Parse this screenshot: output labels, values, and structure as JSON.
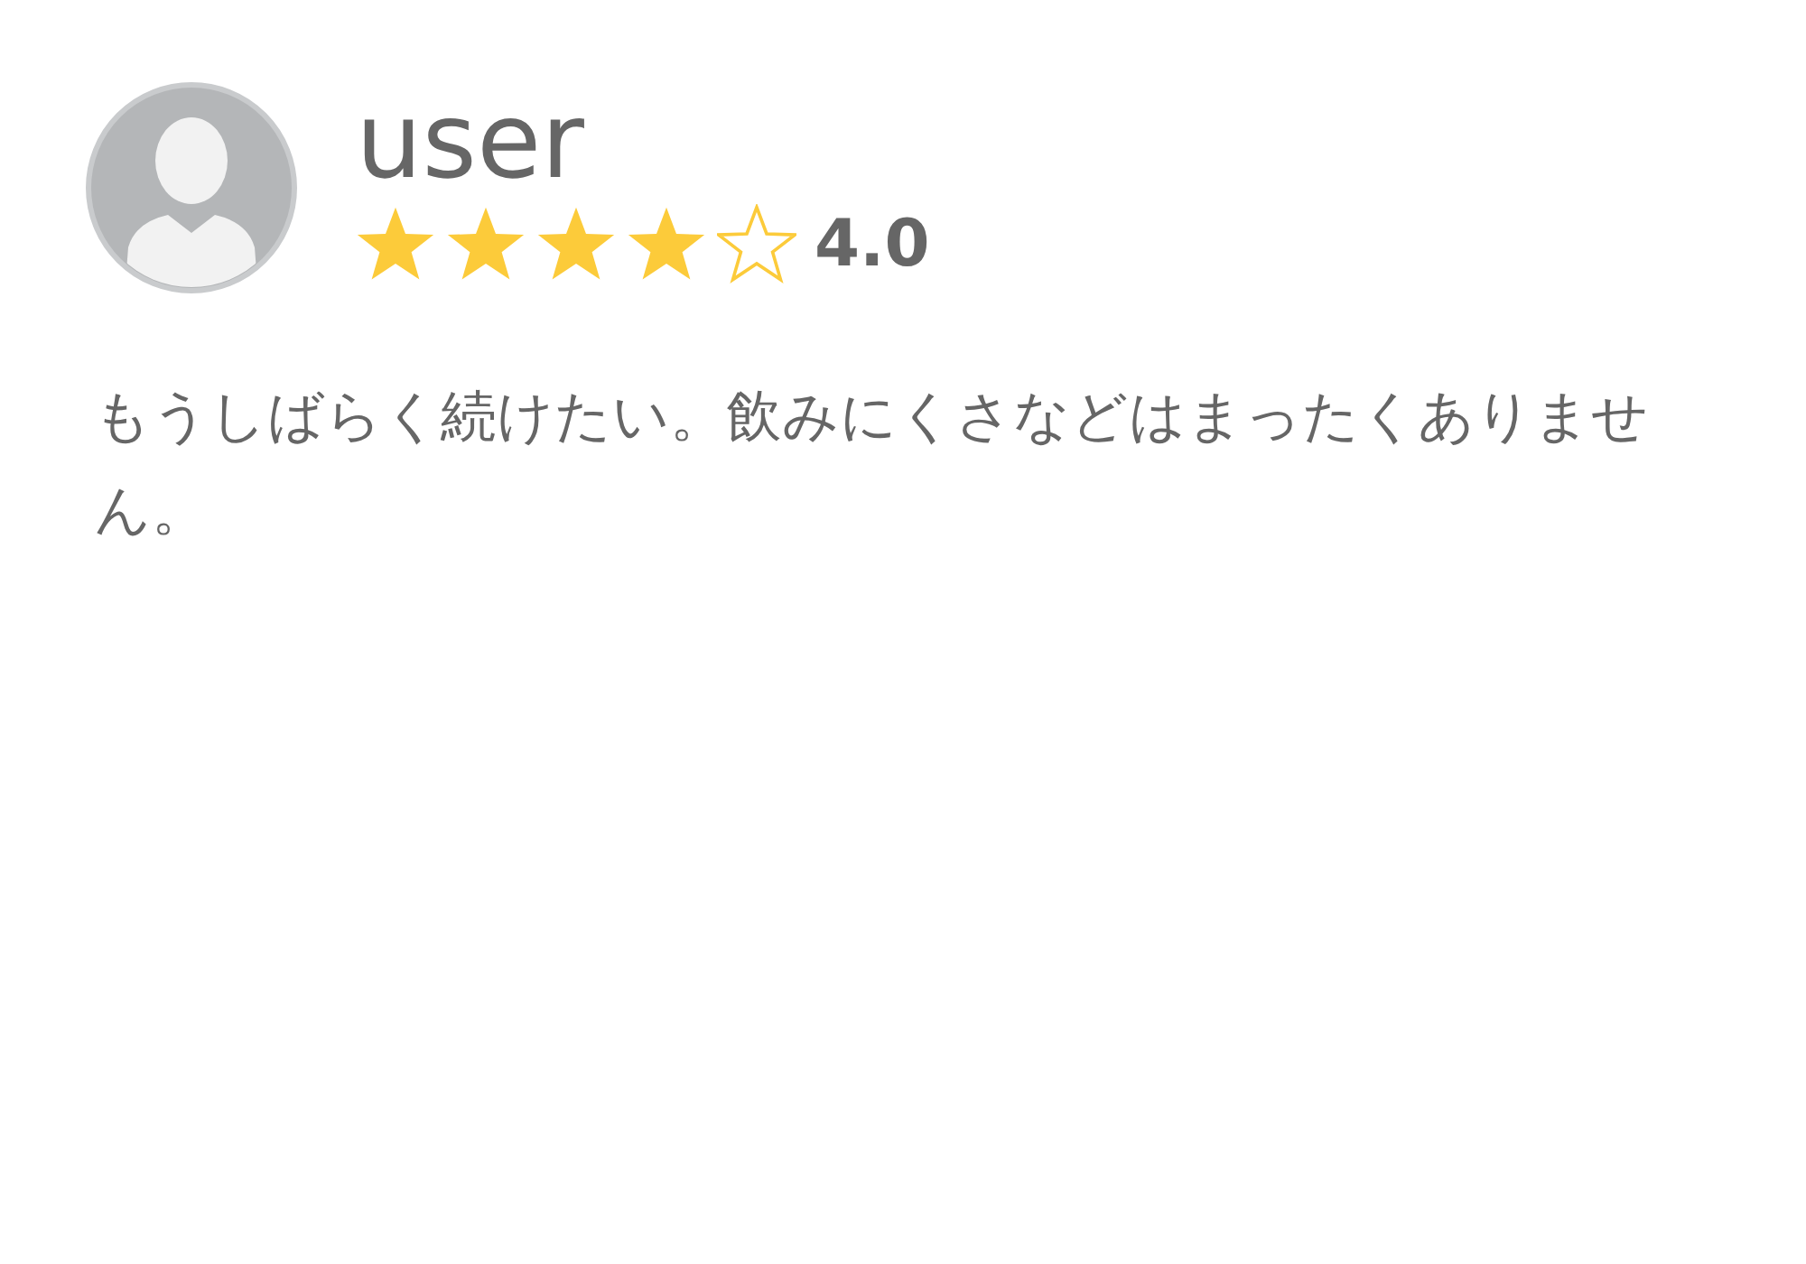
{
  "review": {
    "user": "user",
    "stars": 4,
    "rating": "4.0",
    "text": "もうしばらく続けたい。飲みにくさなどはまったくありません。"
  }
}
